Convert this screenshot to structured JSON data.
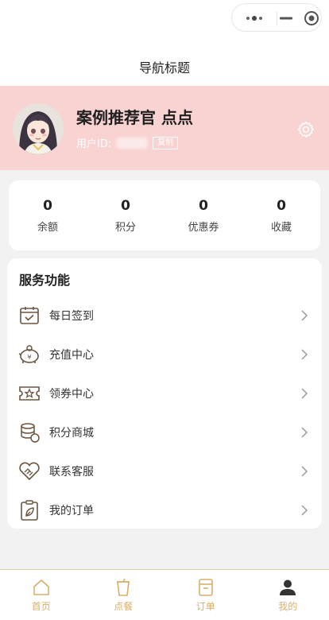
{
  "nav": {
    "title": "导航标题",
    "capsule_icons": [
      "more-dots-icon",
      "minimize-icon",
      "close-circle-icon"
    ]
  },
  "profile": {
    "nickname": "案例推荐官 点点",
    "uid_label": "用户ID:",
    "copy_label": "复制",
    "settings_icon": "gear-icon",
    "background_color": "#f9d2d2"
  },
  "stats": [
    {
      "value": "0",
      "label": "余额"
    },
    {
      "value": "0",
      "label": "积分"
    },
    {
      "value": "0",
      "label": "优惠券"
    },
    {
      "value": "0",
      "label": "收藏"
    }
  ],
  "service": {
    "title": "服务功能",
    "items": [
      {
        "label": "每日签到",
        "icon": "calendar-check-icon"
      },
      {
        "label": "充值中心",
        "icon": "piggy-bank-icon"
      },
      {
        "label": "领券中心",
        "icon": "coupon-ticket-icon"
      },
      {
        "label": "积分商城",
        "icon": "coin-stack-icon"
      },
      {
        "label": "联系客服",
        "icon": "handshake-heart-icon"
      },
      {
        "label": "我的订单",
        "icon": "clipboard-leaf-icon"
      }
    ]
  },
  "tabbar": {
    "active_color": "#333333",
    "inactive_color": "#d8b06a",
    "items": [
      {
        "label": "首页",
        "icon": "home-icon",
        "active": false
      },
      {
        "label": "点餐",
        "icon": "cup-icon",
        "active": false
      },
      {
        "label": "订单",
        "icon": "receipt-icon",
        "active": false
      },
      {
        "label": "我的",
        "icon": "user-icon",
        "active": true
      }
    ]
  }
}
